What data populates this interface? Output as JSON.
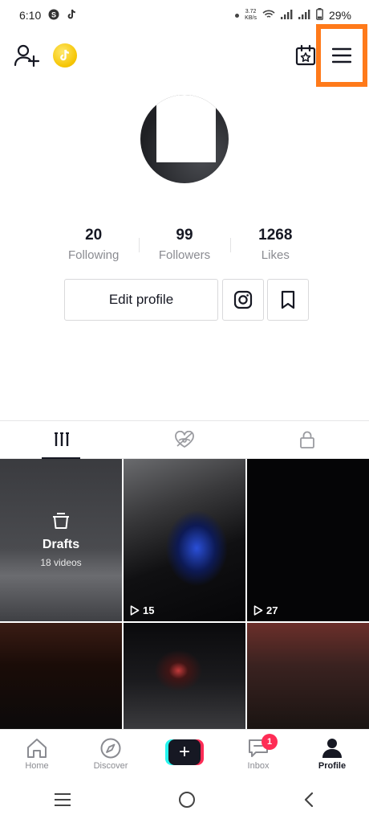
{
  "status_bar": {
    "time": "6:10",
    "net_speed_value": "3.72",
    "net_speed_unit": "KB/s",
    "battery": "29%",
    "icons": [
      "skype-icon",
      "tiktok-icon",
      "dot-icon",
      "wifi-icon",
      "signal-icon",
      "signal-icon",
      "battery-icon"
    ]
  },
  "profile": {
    "stats": [
      {
        "value": "20",
        "label": "Following"
      },
      {
        "value": "99",
        "label": "Followers"
      },
      {
        "value": "1268",
        "label": "Likes"
      }
    ],
    "edit_label": "Edit profile"
  },
  "tabs": [
    "videos-grid-icon",
    "liked-hidden-icon",
    "private-lock-icon"
  ],
  "grid": {
    "drafts_title": "Drafts",
    "drafts_count": "18 videos",
    "videos": [
      {
        "views": "15"
      },
      {
        "views": "27"
      }
    ]
  },
  "bottom_nav": {
    "home": "Home",
    "discover": "Discover",
    "inbox": "Inbox",
    "inbox_badge": "1",
    "profile": "Profile"
  },
  "colors": {
    "accent_highlight": "#ff7a1a",
    "brand_pink": "#fe2c55",
    "brand_cyan": "#25f4ee",
    "coin": "#f5c400"
  }
}
